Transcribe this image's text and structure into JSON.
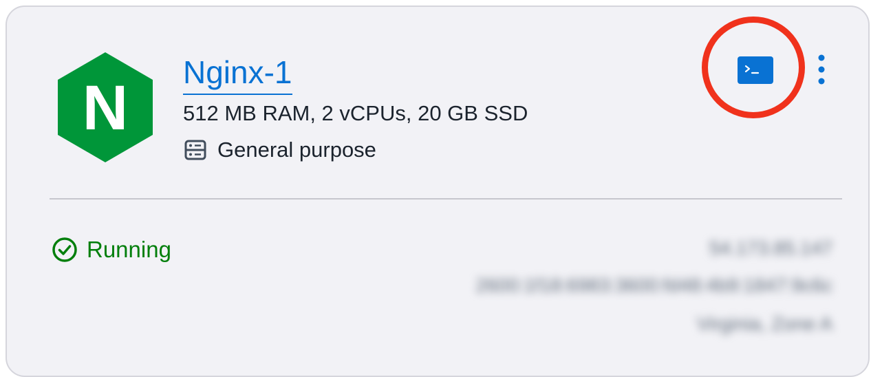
{
  "instance": {
    "name": "Nginx-1",
    "specs": "512 MB RAM, 2 vCPUs, 20 GB SSD",
    "category": "General purpose",
    "category_icon": "server-icon",
    "logo": "nginx-logo",
    "logo_letter": "N",
    "logo_color": "#009639",
    "status": "Running",
    "status_icon": "check-circle-icon",
    "status_color": "#037f0c"
  },
  "actions": {
    "connect_icon": "terminal-icon",
    "connect_color": "#0972d3",
    "more_icon": "vertical-ellipsis-icon"
  },
  "details_blurred": {
    "public_ip": "54.173.85.147",
    "ipv6": "2600:1f18:6983:3600:fd48:4b9:1847:9c6c",
    "zone": "Virginia, Zone A"
  }
}
